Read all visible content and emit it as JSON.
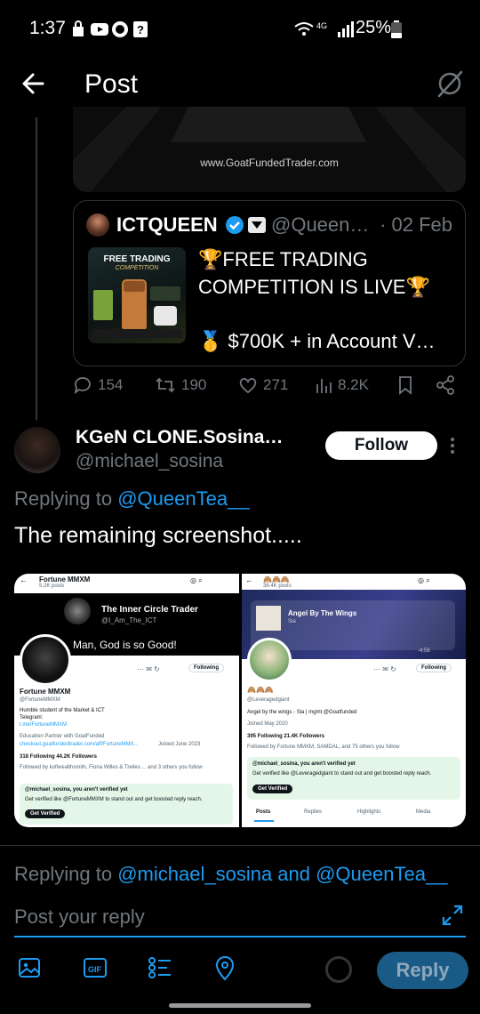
{
  "status_bar": {
    "time": "1:37",
    "battery": "25%"
  },
  "header": {
    "title": "Post"
  },
  "media_top": {
    "site": "www.GoatFundedTrader.com"
  },
  "quote": {
    "name": "ICTQUEEN",
    "handle": "@Queen…",
    "date": "· 02 Feb",
    "image_title": "FREE TRADING",
    "image_subtitle": "COMPETITION",
    "text_line1": "🏆FREE TRADING COMPETITION IS LIVE🏆",
    "text_line2": "🥇 $700K + in Account V…"
  },
  "actions": {
    "replies": "154",
    "reposts": "190",
    "likes": "271",
    "views": "8.2K"
  },
  "reply": {
    "name": "KGeN CLONE.Sosina…",
    "handle": "@michael_sosina",
    "follow_label": "Follow",
    "replying_prefix": "Replying to",
    "replying_to": "@QueenTea__",
    "text": "The remaining screenshot....."
  },
  "left_shot": {
    "name": "Fortune MMXM",
    "posts": "5.2K posts",
    "banner_name": "The Inner Circle Trader",
    "banner_handle": "@I_Am_The_ICT",
    "banner_text": "Man, God is so Good!",
    "following_btn": "Following",
    "profile_name": "Fortune MMXM",
    "profile_handle": "@FortuneMMXM",
    "bio1": "Humble student of the Market & ICT",
    "bio2": "Telegram:",
    "bio_link": "t.me/FortuneMMXM",
    "meta": "Education   Partner with GoatFunded",
    "meta_link": "checkout.goatfundedtrader.com/aff/FortuneMMX...",
    "joined": "Joined June 2023",
    "stats": "318 Following   44.2K Followers",
    "followed_by": "Followed by kofiwealthsmith, Fiona Willes & Treiles ... and 3 others you follow",
    "verify_title": "@michael_sosina, you aren't verified yet",
    "verify_text": "Get verified like @FortuneMMXM to stand out and get boosted reply reach.",
    "verify_btn": "Get Verified"
  },
  "right_shot": {
    "posts": "38.4K posts",
    "song": "Angel By The Wings",
    "artist": "Sia",
    "duration": "-4:56",
    "following_btn": "Following",
    "handle": "@Leveragedgiant",
    "bio": "Angel by the wings - Sia | mgmt @Goatfunded",
    "joined": "Joined May 2020",
    "stats": "395 Following   21.4K Followers",
    "followed_by": "Followed by Fortune MMXM, SAMDAL, and 75 others you follow",
    "verify_title": "@michael_sosina, you aren't verified yet",
    "verify_text": "Get verified like @Leveragedgiant to stand out and get boosted reply reach.",
    "verify_btn": "Get Verified",
    "tabs": [
      "Posts",
      "Replies",
      "Highlights",
      "Media"
    ]
  },
  "compose": {
    "replying_prefix": "Replying to",
    "replying_to": "@michael_sosina and @QueenTea__",
    "placeholder": "Post your reply",
    "reply_label": "Reply"
  },
  "colors": {
    "accent": "#1d9bf0",
    "muted": "#71767b",
    "border": "#2f3336",
    "verified": "#1d9bf0"
  }
}
